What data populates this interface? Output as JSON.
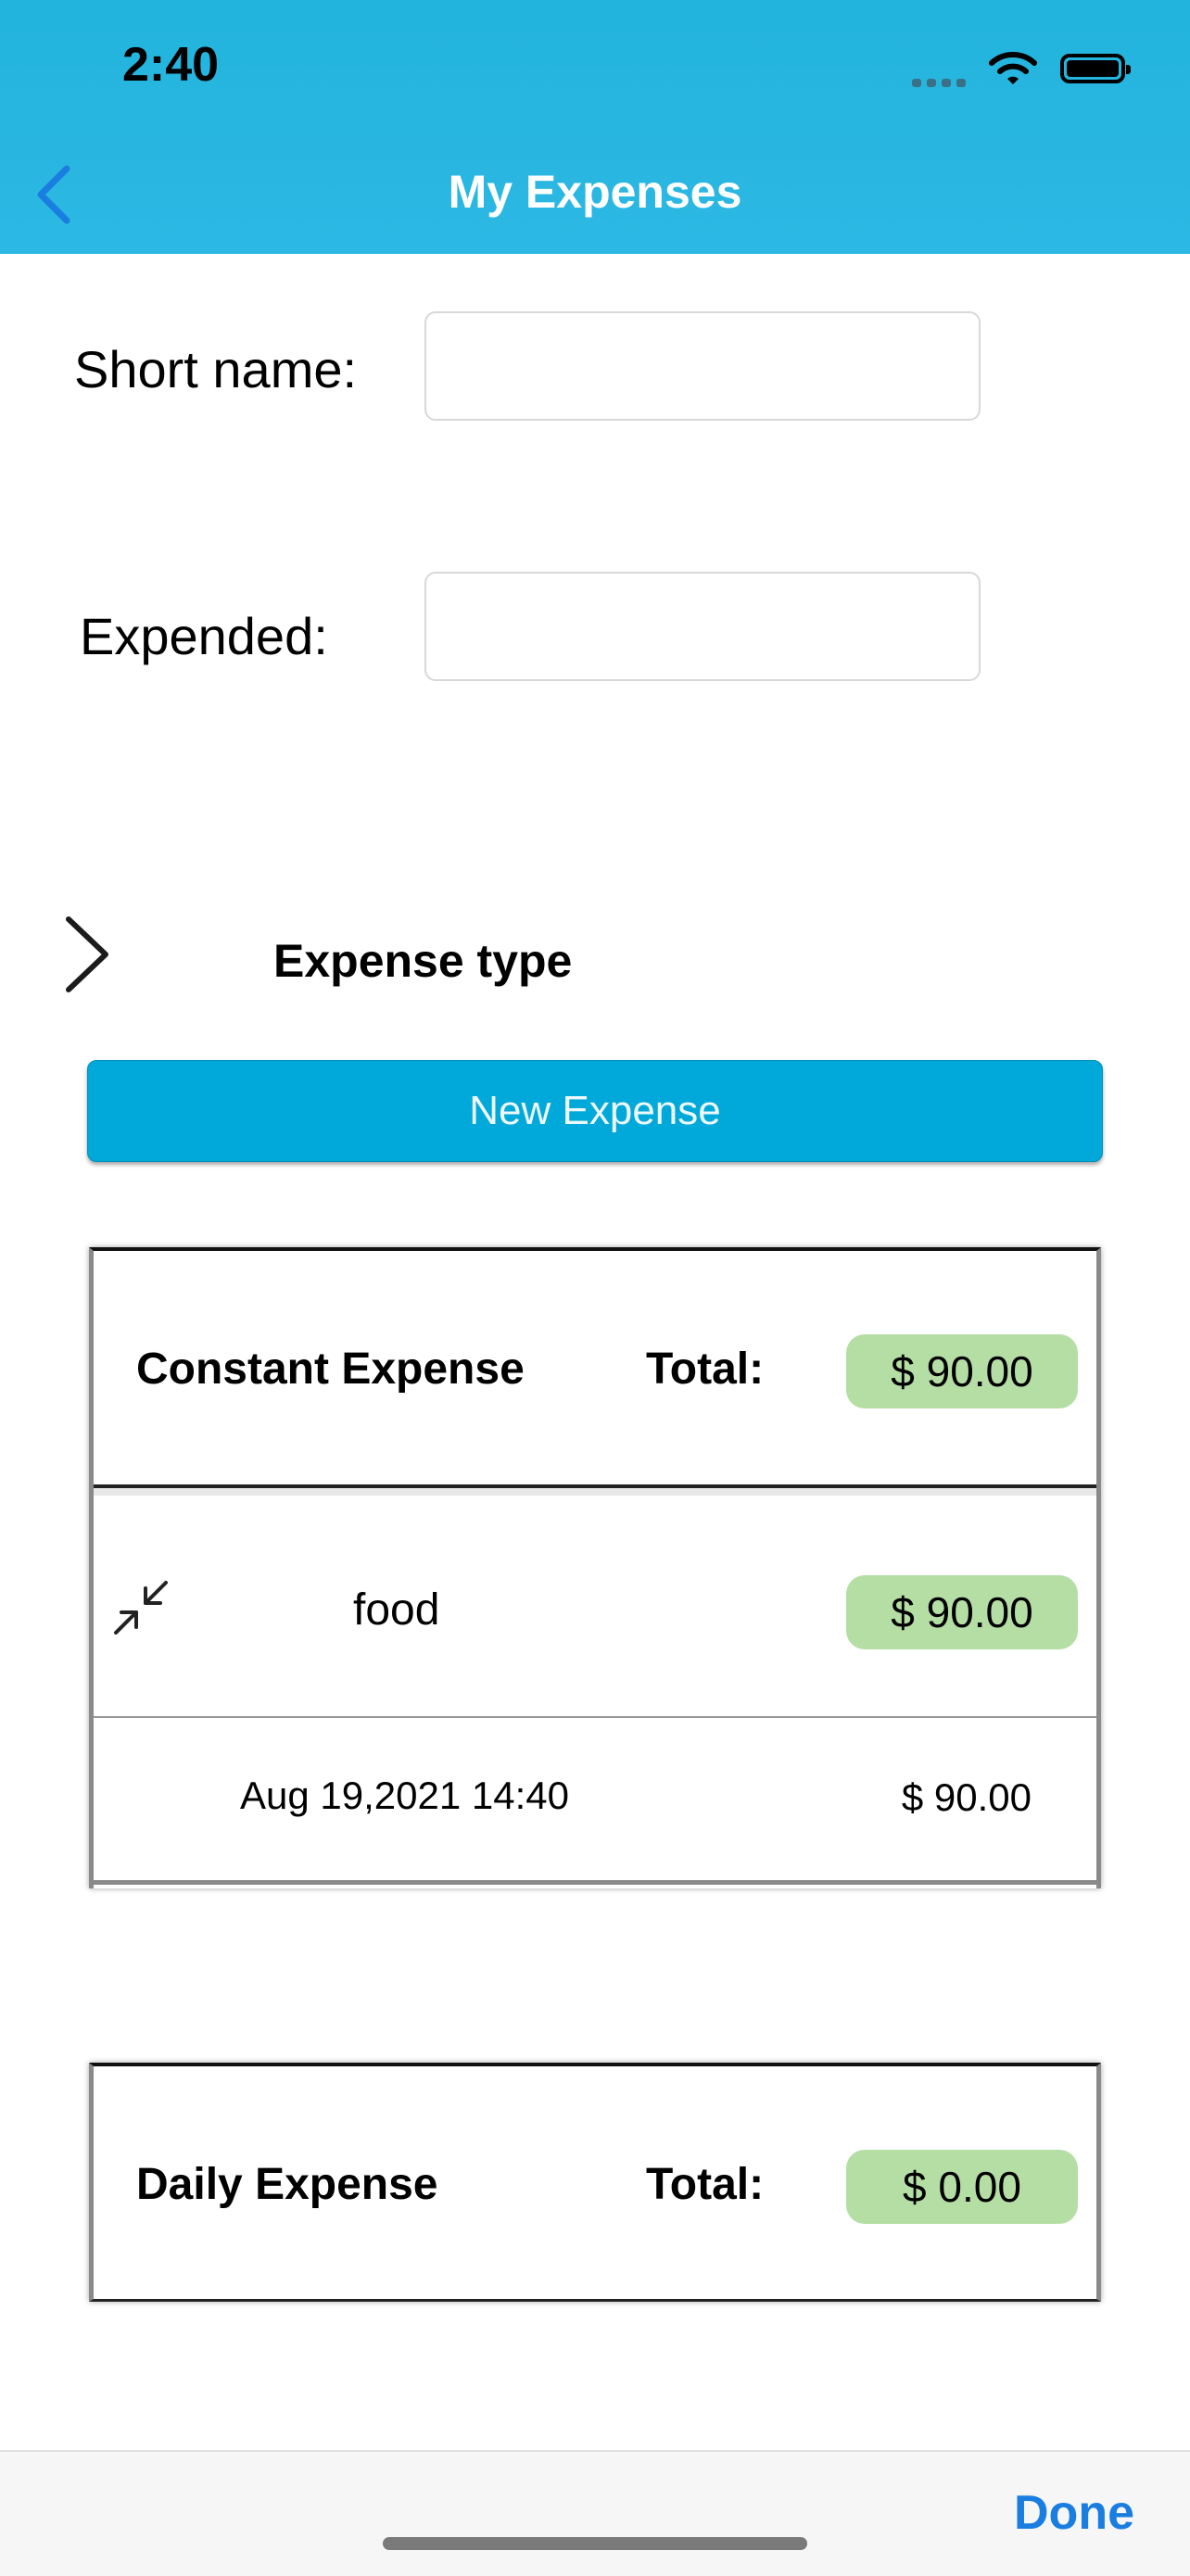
{
  "status_bar": {
    "time": "2:40"
  },
  "nav": {
    "title": "My Expenses"
  },
  "form": {
    "short_name_label": "Short name:",
    "short_name_value": "",
    "expended_label": "Expended:",
    "expended_value": ""
  },
  "expense_type": {
    "title": "Expense type"
  },
  "new_expense_button": "New Expense",
  "groups": [
    {
      "title": "Constant Expense",
      "total_label": "Total:",
      "total": "$ 90.00",
      "items": [
        {
          "name": "food",
          "amount": "$ 90.00",
          "entries": [
            {
              "date": "Aug 19,2021 14:40",
              "amount": "$ 90.00"
            }
          ]
        }
      ]
    },
    {
      "title": "Daily Expense",
      "total_label": "Total:",
      "total": "$ 0.00",
      "items": []
    }
  ],
  "bottom_bar": {
    "done_label": "Done"
  },
  "colors": {
    "header": "#22b4dc",
    "button": "#00a9d9",
    "badge": "#b5dea5",
    "done": "#1a7de0"
  }
}
